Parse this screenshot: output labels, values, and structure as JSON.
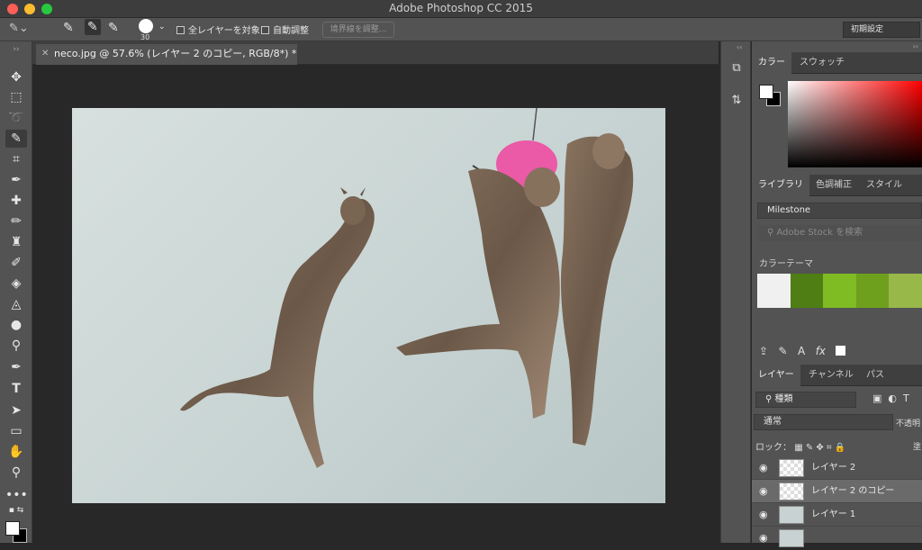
{
  "window": {
    "title": "Adobe Photoshop CC 2015"
  },
  "options": {
    "brush_size": "30",
    "sample_all_layers": "全レイヤーを対象",
    "auto_enhance": "自動調整",
    "refine_edge": "境界線を調整...",
    "workspace": "初期設定"
  },
  "document": {
    "tab_title": "neco.jpg @ 57.6% (レイヤー 2 のコピー, RGB/8*) *"
  },
  "color_panel": {
    "tabs": [
      "カラー",
      "スウォッチ"
    ],
    "foreground": "#ffffff",
    "background": "#000000"
  },
  "library_panel": {
    "tabs": [
      "ライブラリ",
      "色調補正",
      "スタイル"
    ],
    "library_name": "Milestone",
    "search_placeholder": "Adobe Stock を検索",
    "color_theme_label": "カラーテーマ",
    "theme_colors": [
      "#f0f0f0",
      "#4e7e14",
      "#7fbb23",
      "#6ea01d",
      "#98b84a"
    ]
  },
  "layers_panel": {
    "tabs": [
      "レイヤー",
      "チャンネル",
      "パス"
    ],
    "filter_kind": "種類",
    "blend_mode": "通常",
    "opacity_label": "不透明",
    "lock_label": "ロック：",
    "fill_label": "塗",
    "layers": [
      {
        "name": "レイヤー 2",
        "selected": false
      },
      {
        "name": "レイヤー 2 のコピー",
        "selected": true
      },
      {
        "name": "レイヤー 1",
        "selected": false
      }
    ]
  }
}
